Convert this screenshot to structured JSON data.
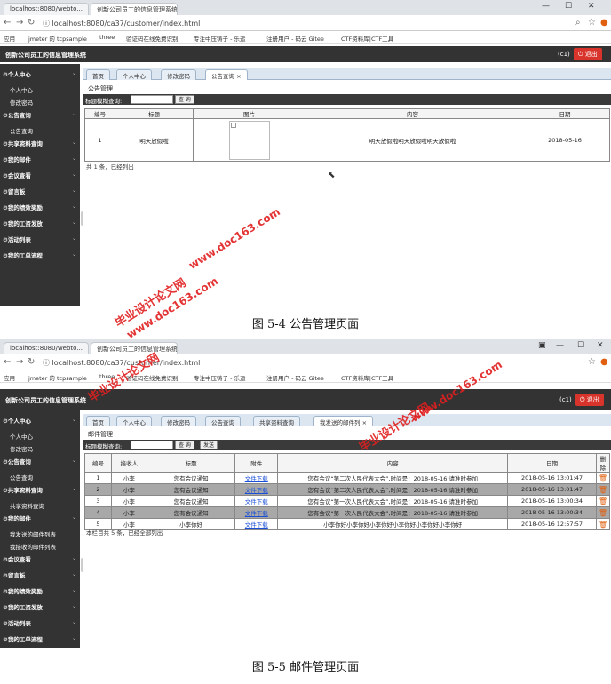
{
  "fig1": {
    "tabs": [
      "localhost:8080/webto...",
      "创新公司员工的信息管理系统 ×"
    ],
    "url": "localhost:8080/ca37/customer/index.html",
    "bookmarks": [
      "应用",
      "jmeter 的 tcpsample",
      "three",
      "验证码在线免费识别",
      "专注中压铸子 - 乐运",
      "注册用户 - 码云 Gitee",
      "CTF资料库|CTF工具"
    ],
    "app_title": "创新公司员工的信息管理系统",
    "user": "(c1)",
    "logout": "退出",
    "menu": [
      {
        "type": "h",
        "label": "个人中心"
      },
      {
        "type": "s",
        "label": "个人中心"
      },
      {
        "type": "s",
        "label": "修改密码"
      },
      {
        "type": "h",
        "label": "公告查询"
      },
      {
        "type": "s",
        "label": "公告查询"
      },
      {
        "type": "h",
        "label": "共享资料查询"
      },
      {
        "type": "h",
        "label": "我的邮件"
      },
      {
        "type": "h",
        "label": "会议查看"
      },
      {
        "type": "h",
        "label": "留言板"
      },
      {
        "type": "h",
        "label": "我的绩效奖励"
      },
      {
        "type": "h",
        "label": "我的工资发放"
      },
      {
        "type": "h",
        "label": "活动列表"
      },
      {
        "type": "h",
        "label": "我的工单流程"
      }
    ],
    "main_tabs": [
      "首页",
      "个人中心",
      "修改密码",
      "公告查询"
    ],
    "section_title": "公告管理",
    "search_label": "标题模糊查询:",
    "search_btn": "查 询",
    "table_headers": [
      "编号",
      "标题",
      "图片",
      "内容",
      "日期"
    ],
    "rows": [
      [
        "1",
        "明天放假啦",
        "",
        "明天放假啦明天放假啦明天放假啦",
        "2018-05-16"
      ]
    ],
    "footer": "共 1 条，已经列出",
    "caption": "图 5-4 公告管理页面"
  },
  "fig2": {
    "tabs": [
      "localhost:8080/webto...",
      "创新公司员工的信息管理系统 ×"
    ],
    "url": "localhost:8080/ca37/customer/index.html",
    "bookmarks": [
      "应用",
      "jmeter 的 tcpsample",
      "three",
      "验证码在线免费识别",
      "专注中压铸子 - 乐运",
      "注册用户 - 码云 Gitee",
      "CTF资料库|CTF工具"
    ],
    "app_title": "创新公司员工的信息管理系统",
    "user": "(c1)",
    "logout": "退出",
    "menu": [
      {
        "type": "h",
        "label": "个人中心"
      },
      {
        "type": "s",
        "label": "个人中心"
      },
      {
        "type": "s",
        "label": "修改密码"
      },
      {
        "type": "h",
        "label": "公告查询"
      },
      {
        "type": "s",
        "label": "公告查询"
      },
      {
        "type": "h",
        "label": "共享资料查询"
      },
      {
        "type": "s",
        "label": "共享资料查询"
      },
      {
        "type": "h",
        "label": "我的邮件"
      },
      {
        "type": "s",
        "label": "我发送的邮件列表"
      },
      {
        "type": "s",
        "label": "我接收的邮件列表"
      },
      {
        "type": "h",
        "label": "会议查看"
      },
      {
        "type": "h",
        "label": "留言板"
      },
      {
        "type": "h",
        "label": "我的绩效奖励"
      },
      {
        "type": "h",
        "label": "我的工资发放"
      },
      {
        "type": "h",
        "label": "活动列表"
      },
      {
        "type": "h",
        "label": "我的工单流程"
      }
    ],
    "main_tabs": [
      "首页",
      "个人中心",
      "修改密码",
      "公告查询",
      "共享资料查询",
      "我发送的邮件列"
    ],
    "section_title": "邮件管理",
    "search_label": "标题模糊查询:",
    "search_btn": "查 询",
    "send_btn": "发送",
    "table_headers": [
      "编号",
      "接收人",
      "标题",
      "附件",
      "内容",
      "日期",
      "删除"
    ],
    "rows": [
      [
        "1",
        "小李",
        "您有会议通知",
        "文件下载",
        "您有会议“第二次人民代表大会”,时间是：2018-05-16,请准时参加",
        "2018-05-16 13:01:47"
      ],
      [
        "2",
        "小李",
        "您有会议通知",
        "文件下载",
        "您有会议“第二次人民代表大会”,时间是：2018-05-16,请准时参加",
        "2018-05-16 13:01:47"
      ],
      [
        "3",
        "小李",
        "您有会议通知",
        "文件下载",
        "您有会议“第一次人民代表大会”,时间是：2018-05-16,请准时参加",
        "2018-05-16 13:00:34"
      ],
      [
        "4",
        "小李",
        "您有会议通知",
        "文件下载",
        "您有会议“第一次人民代表大会”,时间是：2018-05-16,请准时参加",
        "2018-05-16 13:00:34"
      ],
      [
        "5",
        "小李",
        "小李你好",
        "文件下载",
        "小李你好小李你好小李你好小李你好小李你好小李你好",
        "2018-05-16 12:57:57"
      ]
    ],
    "footer": "本栏目共 5 条，已经全部列出",
    "caption": "图 5-5 邮件管理页面"
  },
  "watermarks": {
    "w1a": "www.doc163.com",
    "w1b": "毕业设计论文网",
    "w2a": "www.doc163.com",
    "w2b": "毕业设计论文网",
    "w3a": "毕业设计论文网",
    "w3b": "www.doc163.com"
  },
  "colors": {
    "dark": "#333333",
    "logout": "#d9342b",
    "highlight_row": "#a8a8a8",
    "link": "#1a4fd6",
    "watermark": "#e02020"
  }
}
